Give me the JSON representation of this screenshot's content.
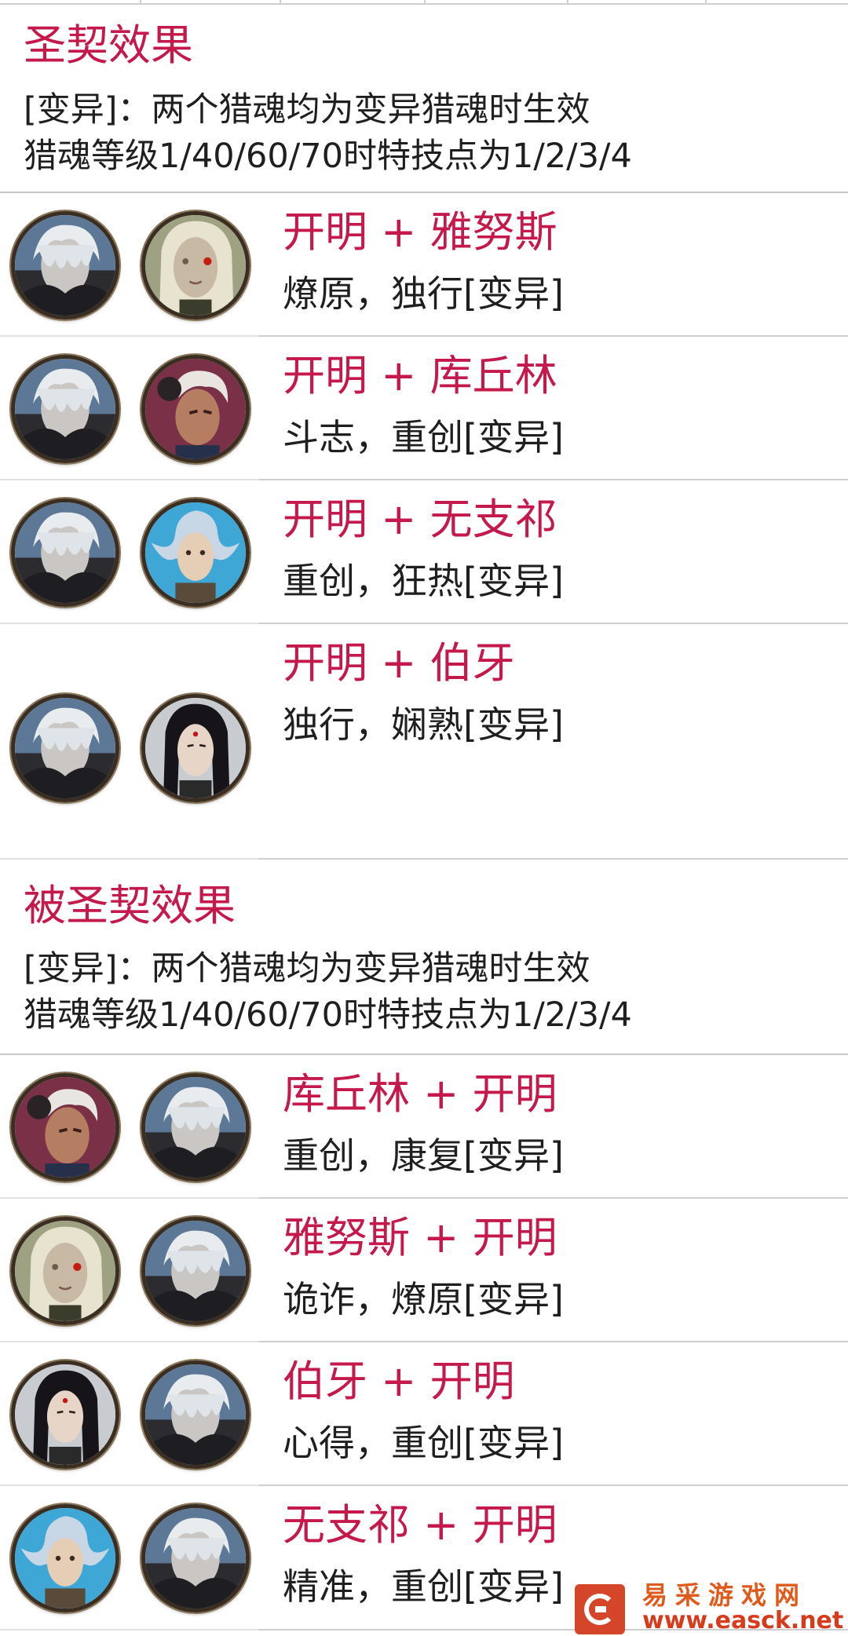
{
  "sections": [
    {
      "title": "圣契效果",
      "desc_line1": "[变异]：两个猎魂均为变异猎魂时生效",
      "desc_line2": "猎魂等级1/40/60/70时特技点为1/2/3/4",
      "rows": [
        {
          "title": "开明 + 雅努斯",
          "skills": "燎原，独行[变异]",
          "avatars": [
            "kaiming",
            "yanusi"
          ]
        },
        {
          "title": "开明 + 库丘林",
          "skills": "斗志，重创[变异]",
          "avatars": [
            "kaiming",
            "kuqiulin"
          ]
        },
        {
          "title": "开明 + 无支祁",
          "skills": "重创，狂热[变异]",
          "avatars": [
            "kaiming",
            "wuzhiqi"
          ]
        },
        {
          "title": "开明 + 伯牙",
          "skills": "独行，娴熟[变异]",
          "avatars": [
            "kaiming",
            "boya"
          ]
        }
      ]
    },
    {
      "title": "被圣契效果",
      "desc_line1": "[变异]：两个猎魂均为变异猎魂时生效",
      "desc_line2": "猎魂等级1/40/60/70时特技点为1/2/3/4",
      "rows": [
        {
          "title": "库丘林 + 开明",
          "skills": "重创，康复[变异]",
          "avatars": [
            "kuqiulin",
            "kaiming"
          ]
        },
        {
          "title": "雅努斯 + 开明",
          "skills": "诡诈，燎原[变异]",
          "avatars": [
            "yanusi",
            "kaiming"
          ]
        },
        {
          "title": "伯牙 + 开明",
          "skills": "心得，重创[变异]",
          "avatars": [
            "boya",
            "kaiming"
          ]
        },
        {
          "title": "无支祁 + 开明",
          "skills": "精准，重创[变异]",
          "avatars": [
            "wuzhiqi",
            "kaiming"
          ]
        }
      ]
    }
  ],
  "watermark": {
    "title": "易采游戏网",
    "url": "www.easck.net"
  },
  "colors": {
    "accent": "#c4194a",
    "text": "#1f1f1f",
    "divider": "#c9c9c9",
    "watermark": "#e05a1c"
  }
}
